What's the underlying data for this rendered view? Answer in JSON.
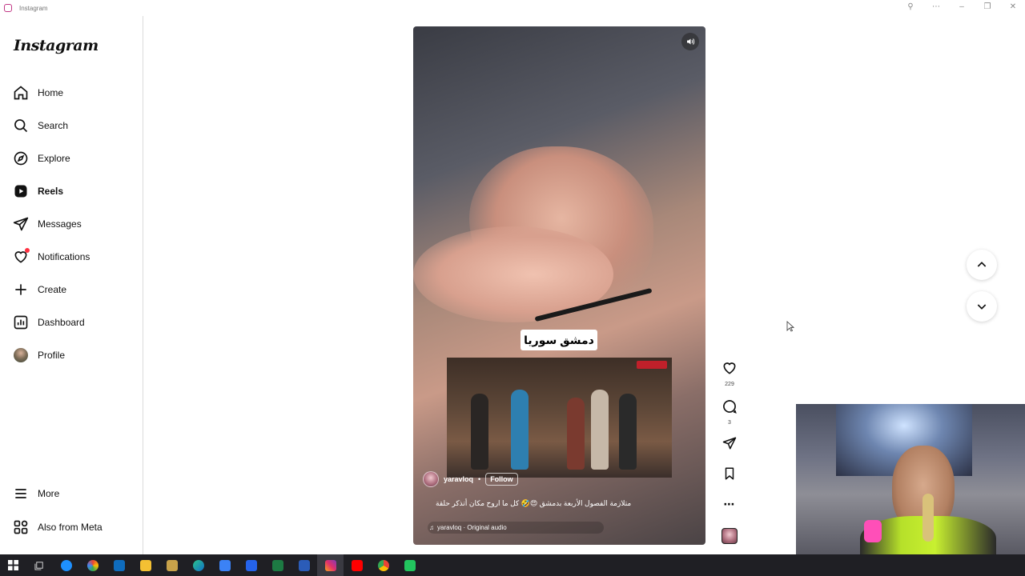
{
  "window": {
    "title": "Instagram"
  },
  "sidebar": {
    "logo": "Instagram",
    "items": [
      {
        "label": "Home",
        "icon": "home-icon"
      },
      {
        "label": "Search",
        "icon": "search-icon"
      },
      {
        "label": "Explore",
        "icon": "compass-icon"
      },
      {
        "label": "Reels",
        "icon": "reels-icon",
        "active": true
      },
      {
        "label": "Messages",
        "icon": "messages-icon"
      },
      {
        "label": "Notifications",
        "icon": "heart-icon",
        "badge": true
      },
      {
        "label": "Create",
        "icon": "plus-icon"
      },
      {
        "label": "Dashboard",
        "icon": "dashboard-icon"
      },
      {
        "label": "Profile",
        "icon": "profile-avatar-icon"
      }
    ],
    "bottom": [
      {
        "label": "More",
        "icon": "menu-icon"
      },
      {
        "label": "Also from Meta",
        "icon": "meta-apps-icon"
      }
    ]
  },
  "reel": {
    "overlay_text": "دمشق سوريا",
    "author": "yaravloq",
    "separator": "•",
    "follow_label": "Follow",
    "caption": "متلازمة الفصول الأربعة بدمشق 😍🤣 كل ما اروح مكان أتذكر حلقة",
    "audio": "yaravloq · Original audio"
  },
  "actions": {
    "likes": "229",
    "comments": "3"
  },
  "colors": {
    "notification_badge": "#ff3040",
    "taskbar": "#1f1f24",
    "sidebar_border": "#dbdbdb"
  }
}
